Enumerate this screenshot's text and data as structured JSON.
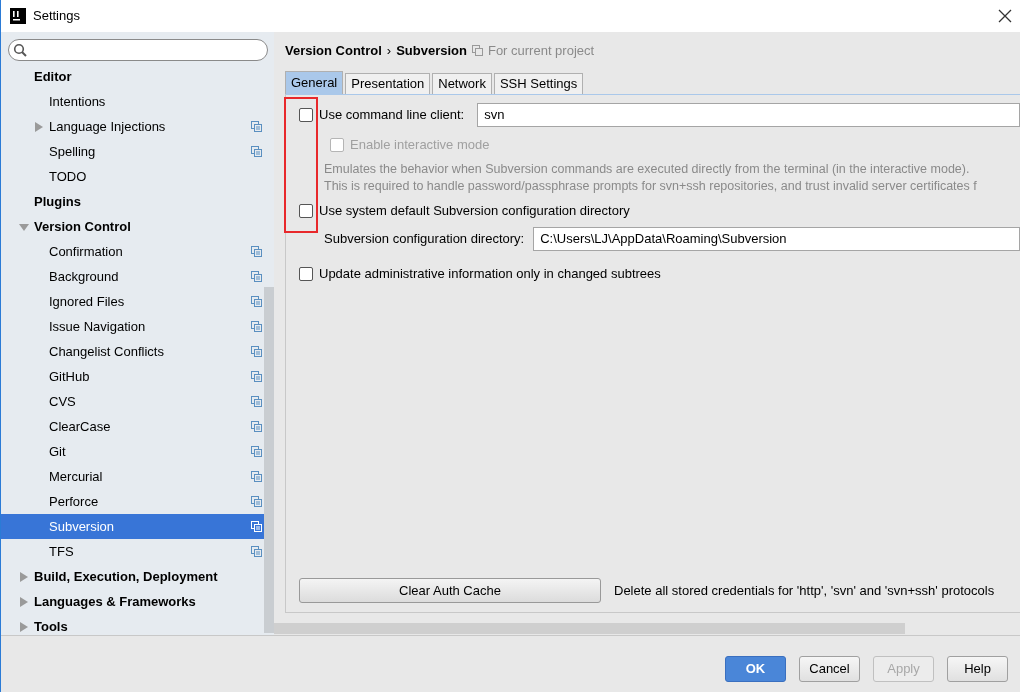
{
  "window": {
    "title": "Settings"
  },
  "sidebar": {
    "items": [
      {
        "label": "Editor",
        "children": [
          {
            "label": "Intentions",
            "project_icon": false,
            "selected": false
          },
          {
            "label": "Language Injections",
            "expanded": false,
            "project_icon": true,
            "selected": false
          },
          {
            "label": "Spelling",
            "project_icon": true,
            "selected": false
          },
          {
            "label": "TODO",
            "project_icon": false,
            "selected": false
          }
        ],
        "selected": false
      },
      {
        "label": "Plugins",
        "selected": false
      },
      {
        "label": "Version Control",
        "expanded": true,
        "selected": false,
        "children": [
          {
            "label": "Confirmation",
            "project_icon": true,
            "selected": false
          },
          {
            "label": "Background",
            "project_icon": true,
            "selected": false
          },
          {
            "label": "Ignored Files",
            "project_icon": true,
            "selected": false
          },
          {
            "label": "Issue Navigation",
            "project_icon": true,
            "selected": false
          },
          {
            "label": "Changelist Conflicts",
            "project_icon": true,
            "selected": false
          },
          {
            "label": "GitHub",
            "project_icon": true,
            "selected": false
          },
          {
            "label": "CVS",
            "project_icon": true,
            "selected": false
          },
          {
            "label": "ClearCase",
            "project_icon": true,
            "selected": false
          },
          {
            "label": "Git",
            "project_icon": true,
            "selected": false
          },
          {
            "label": "Mercurial",
            "project_icon": true,
            "selected": false
          },
          {
            "label": "Perforce",
            "project_icon": true,
            "selected": false
          },
          {
            "label": "Subversion",
            "project_icon": true,
            "selected": true
          },
          {
            "label": "TFS",
            "project_icon": true,
            "selected": false
          }
        ]
      },
      {
        "label": "Build, Execution, Deployment",
        "expanded": false,
        "selected": false
      },
      {
        "label": "Languages & Frameworks",
        "expanded": false,
        "selected": false
      },
      {
        "label": "Tools",
        "expanded": false,
        "selected": false
      }
    ]
  },
  "breadcrumb": {
    "parent": "Version Control",
    "separator": "›",
    "current": "Subversion",
    "scope": "For current project"
  },
  "tabs": [
    {
      "label": "General",
      "selected": true
    },
    {
      "label": "Presentation",
      "selected": false
    },
    {
      "label": "Network",
      "selected": false
    },
    {
      "label": "SSH Settings",
      "selected": false
    }
  ],
  "options": [
    {
      "kind": "checkbox-field",
      "label": "Use command line client:",
      "checked": false,
      "disabled": false,
      "value": "svn"
    },
    {
      "kind": "checkbox",
      "label": "Enable interactive mode",
      "checked": false,
      "disabled": true
    },
    {
      "kind": "note",
      "lines": [
        "Emulates the behavior when Subversion commands are executed directly from the terminal (in the interactive mode).",
        "This is required to handle password/passphrase prompts for svn+ssh repositories, and trust invalid server certificates f"
      ]
    },
    {
      "kind": "checkbox",
      "label": "Use system default Subversion configuration directory",
      "checked": false,
      "disabled": false
    },
    {
      "kind": "field",
      "label": "Subversion configuration directory:",
      "value": "C:\\Users\\LJ\\AppData\\Roaming\\Subversion"
    },
    {
      "kind": "checkbox",
      "label": "Update administrative information only in changed subtrees",
      "checked": false,
      "disabled": false
    }
  ],
  "clear_cache": {
    "button": "Clear Auth Cache",
    "note": "Delete all stored credentials for 'http', 'svn' and 'svn+ssh' protocols"
  },
  "annotations": [
    {
      "kind": "frame"
    }
  ],
  "buttons": [
    {
      "label": "OK",
      "kind": "primary",
      "disabled": false
    },
    {
      "label": "Cancel",
      "kind": "normal",
      "disabled": false
    },
    {
      "label": "Apply",
      "kind": "normal",
      "disabled": true
    },
    {
      "label": "Help",
      "kind": "normal",
      "disabled": false
    }
  ]
}
